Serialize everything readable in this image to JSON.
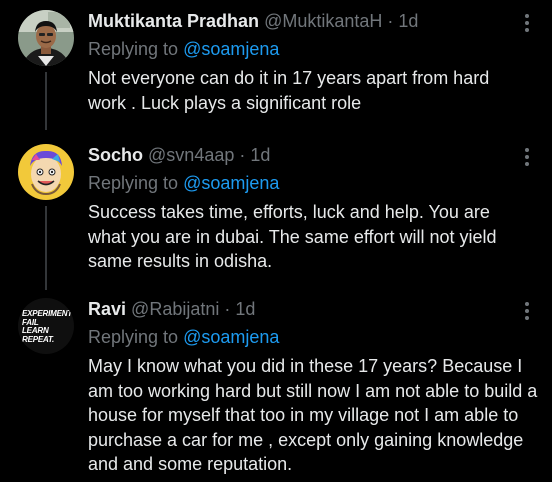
{
  "colors": {
    "background": "#000000",
    "text": "#e7e9ea",
    "muted": "#71767b",
    "accent": "#1d9bf0",
    "thread_line": "#333639"
  },
  "replies": [
    {
      "name": "Muktikanta Pradhan",
      "handle": "@MuktikantaH",
      "separator": "·",
      "time": "1d",
      "replying_prefix": "Replying to",
      "mention": "@soamjena",
      "text": "Not everyone can do it in 17 years apart from hard work . Luck plays a significant role",
      "avatar": "profile-photo-man-icon"
    },
    {
      "name": "Socho",
      "handle": "@svn4aap",
      "separator": "·",
      "time": "1d",
      "replying_prefix": "Replying to",
      "mention": "@soamjena",
      "text": "Success takes time, efforts, luck and help. You are what you are in dubai. The same effort will not yield same results in odisha.",
      "avatar": "cartoon-face-icon"
    },
    {
      "name": "Ravi",
      "handle": "@Rabijatni",
      "separator": "·",
      "time": "1d",
      "replying_prefix": "Replying to",
      "mention": "@soamjena",
      "text": "May I know what you did in these 17 years? Because I am too working hard but still now I am not able to build a house for myself that too in my village not I am able to purchase a car for me , except only gaining knowledge and and some reputation.",
      "avatar": "experiment-logo-icon",
      "avatar_text": [
        "EXPERIMENT",
        "FAIL",
        "LEARN",
        "REPEAT."
      ]
    }
  ]
}
